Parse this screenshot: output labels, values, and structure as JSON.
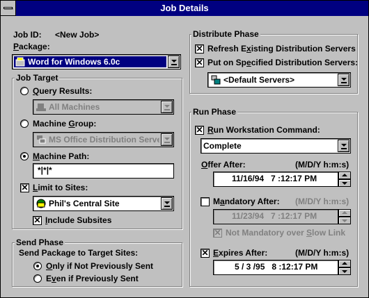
{
  "window": {
    "title": "Job Details"
  },
  "job": {
    "id_label": "Job ID:",
    "id_value": "<New Job>",
    "package_label": "Package:",
    "package_value": "Word for Windows 6.0c"
  },
  "job_target": {
    "group_label": "Job Target",
    "query_results": {
      "label": "Query Results:",
      "selected": false,
      "value": "All Machines"
    },
    "machine_group": {
      "label": "Machine Group:",
      "selected": false,
      "value": "MS Office Distribution Serve"
    },
    "machine_path": {
      "label": "Machine Path:",
      "selected": true,
      "value": "*|*|*"
    },
    "limit_to_sites": {
      "label": "Limit to Sites:",
      "checked": true,
      "value": "Phil's Central Site"
    },
    "include_subsites": {
      "label": "Include Subsites",
      "checked": true
    }
  },
  "send_phase": {
    "group_label": "Send Phase",
    "prompt": "Send Package to Target Sites:",
    "only_if_not_sent": {
      "label": "Only if Not Previously Sent",
      "selected": true
    },
    "even_if_sent": {
      "label": "Even if Previously Sent",
      "selected": false
    }
  },
  "distribute_phase": {
    "group_label": "Distribute Phase",
    "refresh_servers": {
      "label": "Refresh Existing Distribution Servers",
      "checked": true
    },
    "put_on_servers": {
      "label": "Put on Specified Distribution Servers:",
      "checked": true
    },
    "servers_value": "<Default Servers>"
  },
  "run_phase": {
    "group_label": "Run Phase",
    "run_command": {
      "label": "Run Workstation Command:",
      "checked": true,
      "value": "Complete"
    },
    "offer_after": {
      "label": "Offer After:",
      "format": "(M/D/Y h:m:s)",
      "value": "11/16/94   7 :12:17 PM"
    },
    "mandatory_after": {
      "label": "Mandatory After:",
      "checked": false,
      "value": "11/23/94   7 :12:17 PM"
    },
    "not_mandatory_slow_link": {
      "label": "Not Mandatory over Slow Link",
      "checked": true
    },
    "expires_after": {
      "label": "Expires After:",
      "format": "(M/D/Y h:m:s)",
      "checked": true,
      "value": "5 / 3 /95   8 :12:17 PM"
    }
  },
  "colors": {
    "title_bar": "#000080",
    "face": "#c0c0c0",
    "selection": "#000080",
    "disabled_text": "#808080"
  },
  "icons": [
    "system-menu-icon",
    "package-icon",
    "query-icon",
    "machine-group-icon",
    "site-icon",
    "servers-icon",
    "dropdown-arrow-icon",
    "spin-up-icon",
    "spin-down-icon",
    "checkmark-icon"
  ]
}
